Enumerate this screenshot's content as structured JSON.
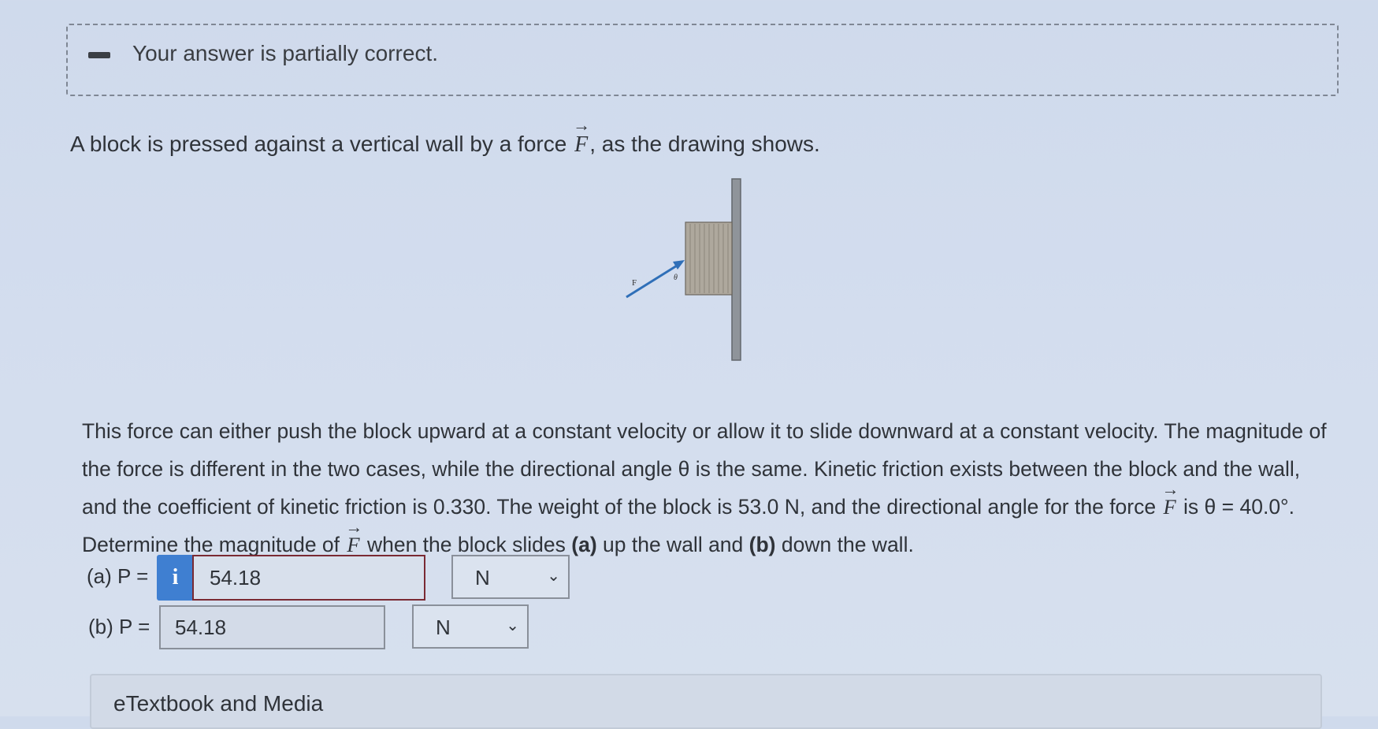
{
  "feedback": {
    "message": "Your answer is partially correct."
  },
  "problem": {
    "intro_pre": "A block is pressed against a vertical wall by a force",
    "force_symbol": "F",
    "intro_post": ", as the drawing shows.",
    "para_1": "This force can either push the block upward at a constant velocity or allow it to slide downward at a constant velocity. The magnitude of the force is different in the two cases, while the directional angle θ is the same. Kinetic friction exists between the block and the wall, and the coefficient of kinetic friction is 0.330. The weight of the block is 53.0 N, and the directional angle for the force",
    "para_2": "is θ = 40.0°. Determine the magnitude of",
    "para_3_pre": "when the block slides",
    "part_a_tag": "(a)",
    "part_a_text": "up the wall and",
    "part_b_tag": "(b)",
    "part_b_text": "down the wall."
  },
  "diagram": {
    "force_label": "F",
    "angle_label": "θ"
  },
  "answers": {
    "a": {
      "label": "(a) P =",
      "info_icon": "i",
      "value": "54.18",
      "unit": "N"
    },
    "b": {
      "label": "(b) P =",
      "value": "54.18",
      "unit": "N"
    }
  },
  "media": {
    "label": "eTextbook and Media"
  },
  "icons": {
    "info": "info-icon",
    "chevron": "chevron-down-icon",
    "status": "minus-icon"
  },
  "colors": {
    "info_button": "#3f7fd1",
    "input_border_a": "#7a2a33"
  }
}
